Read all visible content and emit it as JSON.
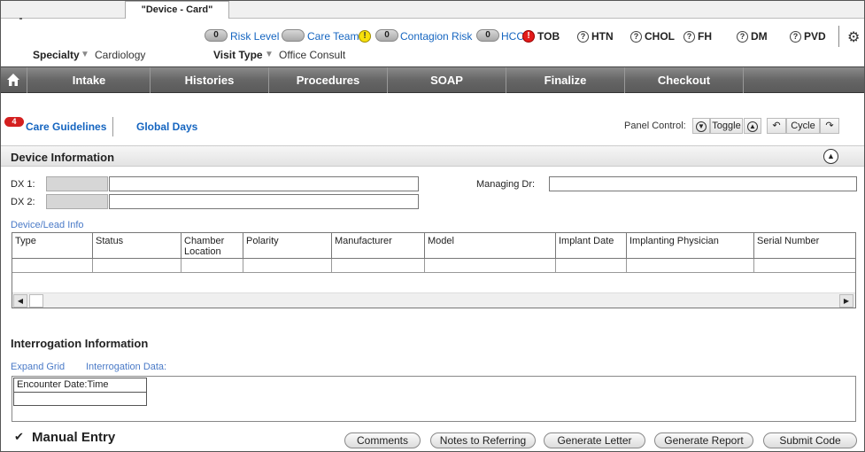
{
  "tab": {
    "title": "\"Device - Card\""
  },
  "status": {
    "risk_count": "0",
    "risk_label": "Risk Level",
    "care_team_label": "Care Team",
    "warn_glyph": "!",
    "contagion_count": "0",
    "contagion_label": "Contagion Risk",
    "hcc_count": "0",
    "hcc_label": "HCC",
    "alert_glyph": "!",
    "tob_label": "TOB",
    "q_glyph": "?",
    "htn_label": "HTN",
    "chol_label": "CHOL",
    "fh_label": "FH",
    "dm_label": "DM",
    "pvd_label": "PVD"
  },
  "meta": {
    "specialty_label": "Specialty",
    "specialty_value": "Cardiology",
    "visit_label": "Visit Type",
    "visit_value": "Office Consult",
    "arrow_glyph": "▼"
  },
  "nav": {
    "items": [
      "Intake",
      "Histories",
      "Procedures",
      "SOAP",
      "Finalize",
      "Checkout"
    ]
  },
  "guidelines": {
    "badge": "4",
    "care_label": "Care Guidelines",
    "global_label": "Global Days",
    "panel_control_label": "Panel Control:",
    "toggle_label": "Toggle",
    "cycle_label": "Cycle"
  },
  "device": {
    "title": "Device Information",
    "dx1_label": "DX 1:",
    "dx2_label": "DX 2:",
    "managing_label": "Managing Dr:",
    "lead_info_label": "Device/Lead Info",
    "columns": [
      "Type",
      "Status",
      "Chamber Location",
      "Polarity",
      "Manufacturer",
      "Model",
      "Implant Date",
      "Implanting Physician",
      "Serial Number"
    ]
  },
  "interrogation": {
    "title": "Interrogation Information",
    "expand_label": "Expand Grid",
    "data_label": "Interrogation Data:",
    "column": "Encounter Date:Time"
  },
  "footer": {
    "check_glyph": "✔",
    "manual_entry_label": "Manual Entry",
    "buttons": [
      "Comments",
      "Notes to Referring",
      "Generate Letter",
      "Generate Report",
      "Submit Code"
    ]
  }
}
